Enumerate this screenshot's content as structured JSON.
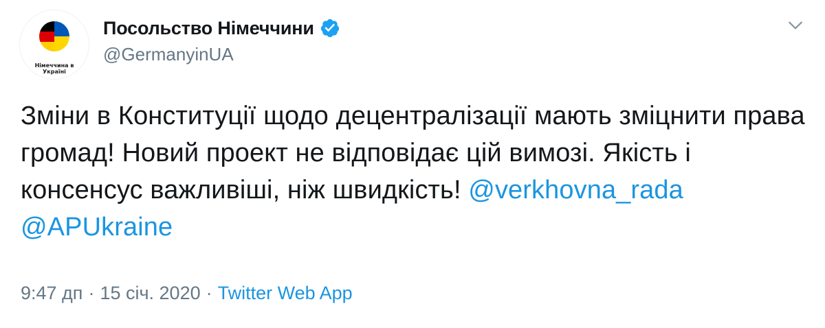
{
  "account": {
    "display_name": "Посольство Німеччини",
    "handle": "@GermanyinUA",
    "verified": true,
    "avatar_caption_line1": "Німеччина в",
    "avatar_caption_line2": "Україні"
  },
  "tweet": {
    "text_part1": "Зміни в Конституції щодо децентралізації мають зміцнити права громад! Новий проект не відповідає цій вимозі. Якість і консенсус важливіші, ніж швидкість! ",
    "mention1": "@verkhovna_rada",
    "mention2": "@APUkraine"
  },
  "meta": {
    "time": "9:47 дп",
    "date": "15 січ. 2020",
    "source": "Twitter Web App",
    "separator": "·"
  },
  "colors": {
    "link": "#1b95e0",
    "secondary_text": "#657786",
    "primary_text": "#14171a",
    "verified_badge": "#1da1f2",
    "flag_black": "#000000",
    "flag_red": "#dd0000",
    "flag_gold": "#ffce00",
    "flag_blue": "#0057b7"
  },
  "icons": {
    "verified": "verified-badge-icon",
    "menu": "chevron-down-icon"
  }
}
